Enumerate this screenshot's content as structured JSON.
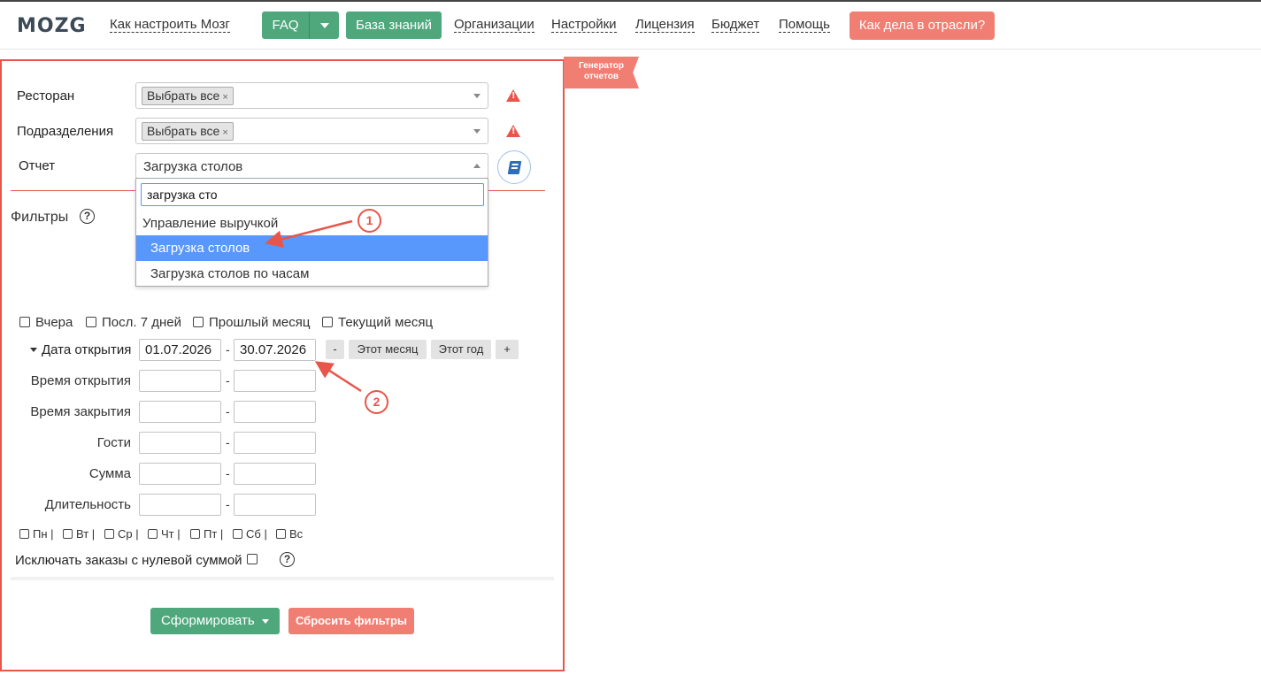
{
  "nav": {
    "logo": "MOZG",
    "links": [
      "Как настроить Мозг",
      "Организации",
      "Настройки",
      "Лицензия",
      "Бюджет",
      "Помощь"
    ],
    "faq": "FAQ",
    "knowledge_base": "База знаний",
    "industry": "Как дела в отрасли?"
  },
  "ribbon": "Генератор отчетов",
  "form": {
    "restaurant_label": "Ресторан",
    "division_label": "Подразделения",
    "report_label": "Отчет",
    "select_all_tag": "Выбрать все",
    "tag_remove": "×",
    "report_value": "Загрузка столов",
    "warn_symbol": "!",
    "filters_title": "Фильтры",
    "help_symbol": "?"
  },
  "dropdown": {
    "search_value": "загрузка сто",
    "group": "Управление выручкой",
    "options": [
      "Загрузка столов",
      "Загрузка столов по часам"
    ]
  },
  "quick_periods": [
    "Вчера",
    "Посл. 7 дней",
    "Прошлый месяц",
    "Текущий месяц"
  ],
  "filters": {
    "open_date_label": "Дата открытия",
    "date_from": "01.07.2026",
    "date_to": "30.07.2026",
    "minus": "-",
    "this_month": "Этот месяц",
    "this_year": "Этот год",
    "plus": "+",
    "dash": "-",
    "rows": [
      "Время открытия",
      "Время закрытия",
      "Гости",
      "Сумма",
      "Длительность"
    ]
  },
  "weekdays": [
    "Пн |",
    "Вт |",
    "Ср |",
    "Чт |",
    "Пт |",
    "Сб |",
    "Вс"
  ],
  "exclude_zero": "Исключать заказы с нулевой суммой",
  "actions": {
    "generate": "Сформировать",
    "reset": "Сбросить фильтры"
  },
  "annotations": [
    "1",
    "2"
  ],
  "colors": {
    "green": "#4fa77c",
    "coral": "#f07e72",
    "red_border": "#e8554a",
    "highlight": "#5897fb"
  }
}
